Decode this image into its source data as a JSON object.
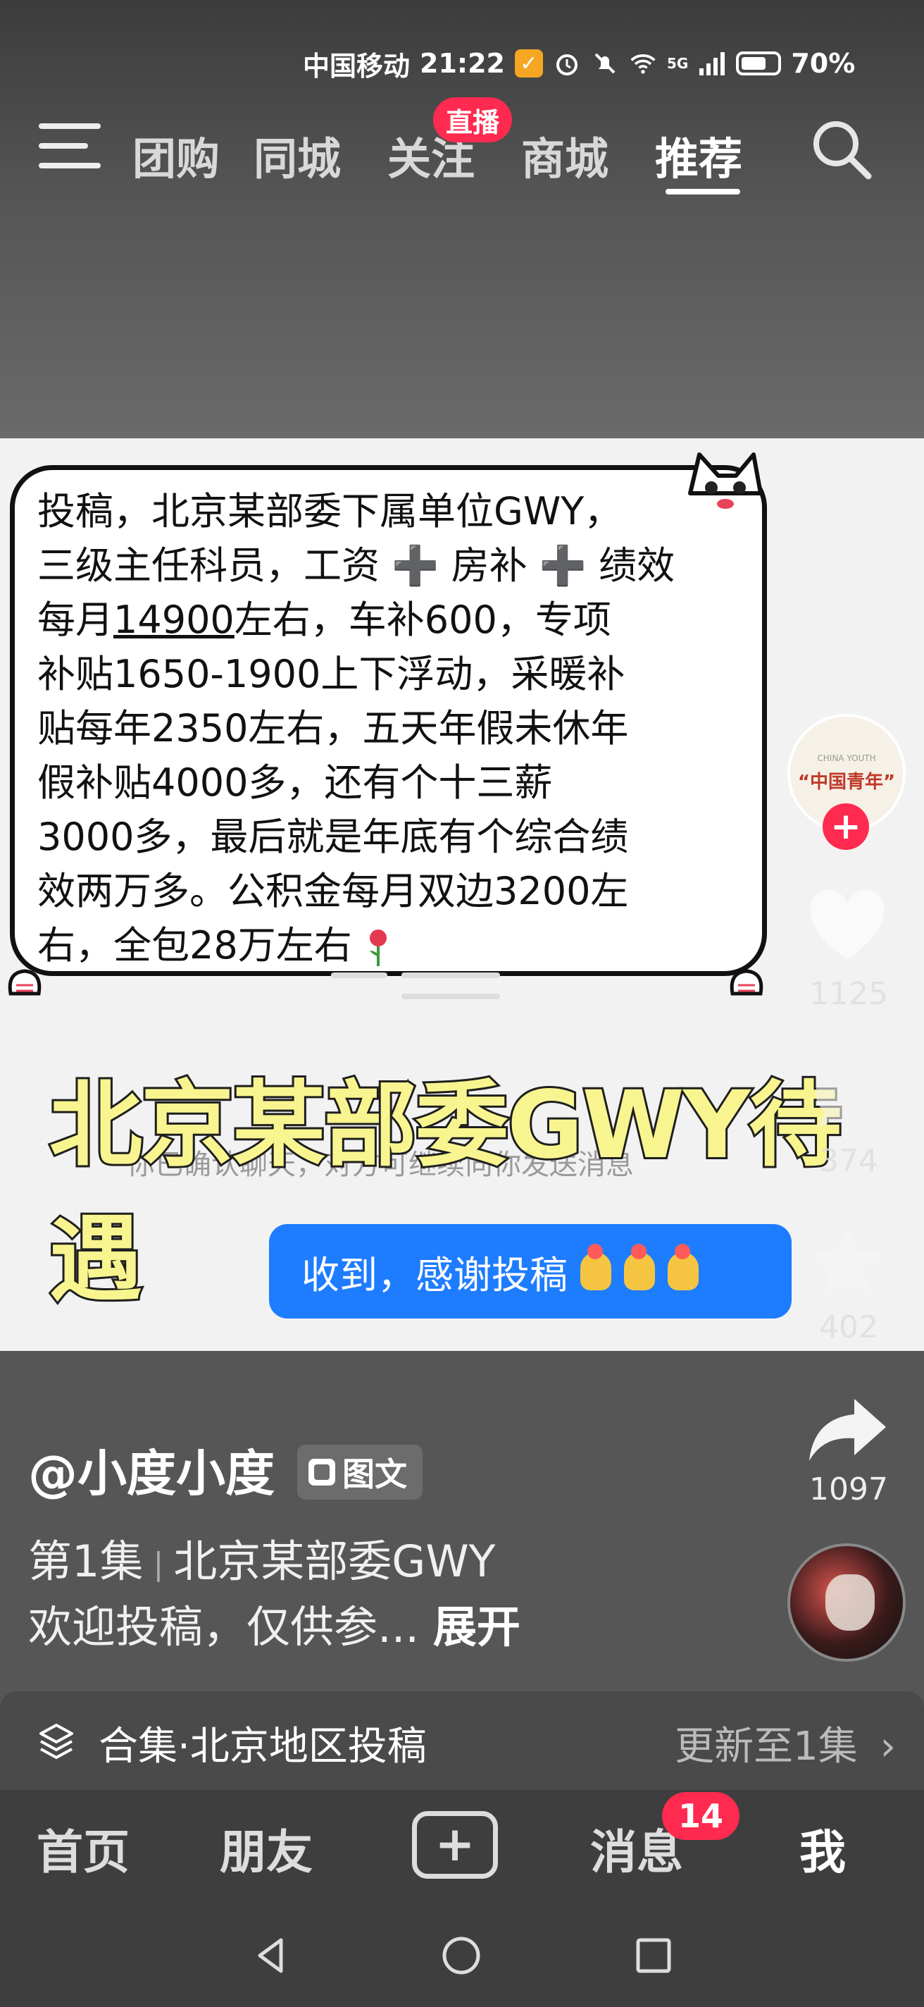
{
  "status_bar": {
    "carrier": "中国移动",
    "time": "21:22",
    "network": "5G",
    "battery": "70%"
  },
  "top_nav": {
    "tabs": [
      {
        "label": "团购"
      },
      {
        "label": "同城"
      },
      {
        "label": "关注",
        "badge": "直播"
      },
      {
        "label": "商城"
      },
      {
        "label": "推荐",
        "active": true
      }
    ],
    "menu_icon": "menu-icon",
    "search_icon": "search-icon"
  },
  "post": {
    "bubble_lines": [
      "投稿，北京某部委下属单位GWY，",
      "三级主任科员，工资 ➕ 房补 ➕ 绩效",
      "左右，车补600，专项",
      "补贴1650-1900上下浮动，采暖补",
      "贴每年2350左右，五天年假未休年",
      "假补贴4000多，还有个十三薪",
      " 3000多，最后就是年底有个综合绩",
      "效两万多。公积金每月双边3200左",
      "右，全包28万左右"
    ],
    "bubble_line3_prefix": "每月",
    "bubble_line3_underlined": "14900",
    "overlay_title": "北京某部委GWY待遇",
    "system_message": "你已确认聊天，对方可继续向你发送消息",
    "reply_text": "收到，感谢投稿"
  },
  "side_actions": {
    "author_account_logo_text": "“中国青年”",
    "author_account_logo_small": "CHINA YOUTH",
    "follow_icon": "plus-icon",
    "likes": "1125",
    "comments": "374",
    "favorites": "402",
    "shares": "1097"
  },
  "description": {
    "author": "@小度小度",
    "tag": "图文",
    "episode": "第1集",
    "episode_title": "北京某部委GWY",
    "text": "欢迎投稿，仅供参...",
    "expand": "展开"
  },
  "collection": {
    "label": "合集·北京地区投稿",
    "update": "更新至1集",
    "arrow": "›"
  },
  "bottom_nav": {
    "home": "首页",
    "friends": "朋友",
    "post": "+",
    "messages": "消息",
    "messages_badge": "14",
    "me": "我"
  },
  "colors": {
    "accent_red": "#ff2a4f",
    "reply_blue": "#1e7cff",
    "overlay_yellow": "#f8f590"
  }
}
